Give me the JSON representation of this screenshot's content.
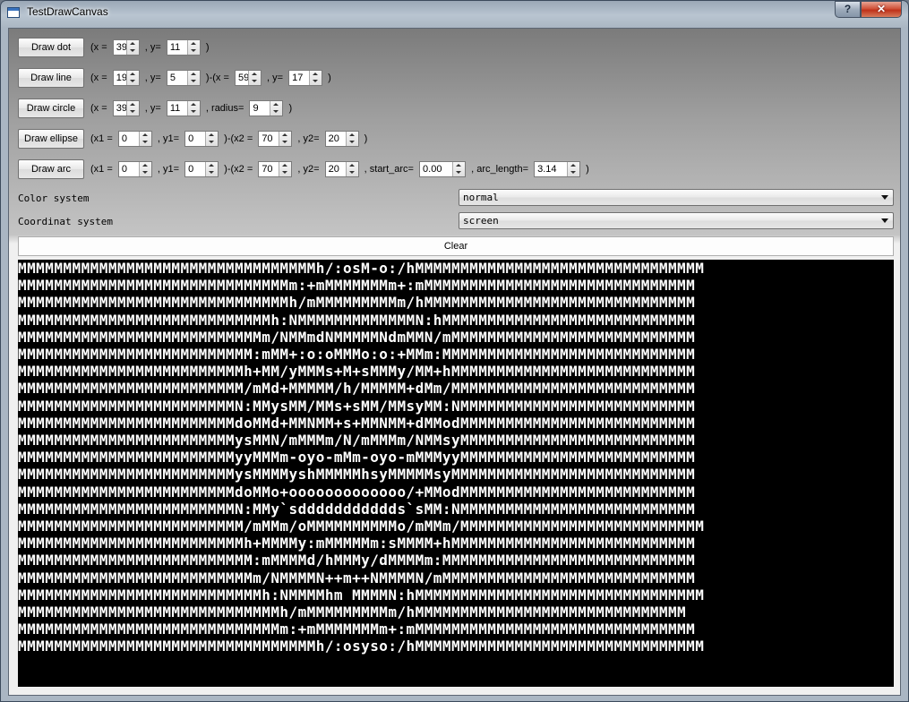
{
  "window": {
    "title": "TestDrawCanvas",
    "help_label": "?",
    "close_label": "✕",
    "app_icon": "window-app-icon"
  },
  "rows": [
    {
      "button": "Draw dot",
      "parts": [
        {
          "t": "lbl",
          "v": "(x = "
        },
        {
          "t": "spin",
          "v": "39",
          "w": 30
        },
        {
          "t": "lbl",
          "v": " , y= "
        },
        {
          "t": "spin",
          "v": "11",
          "w": 38
        },
        {
          "t": "lbl",
          "v": " )"
        }
      ]
    },
    {
      "button": "Draw line",
      "parts": [
        {
          "t": "lbl",
          "v": "(x = "
        },
        {
          "t": "spin",
          "v": "19",
          "w": 30
        },
        {
          "t": "lbl",
          "v": " , y= "
        },
        {
          "t": "spin",
          "v": "5",
          "w": 38
        },
        {
          "t": "lbl",
          "v": " )-(x = "
        },
        {
          "t": "spin",
          "v": "59",
          "w": 30
        },
        {
          "t": "lbl",
          "v": " , y= "
        },
        {
          "t": "spin",
          "v": "17",
          "w": 38
        },
        {
          "t": "lbl",
          "v": " )"
        }
      ]
    },
    {
      "button": "Draw circle",
      "parts": [
        {
          "t": "lbl",
          "v": "(x = "
        },
        {
          "t": "spin",
          "v": "39",
          "w": 30
        },
        {
          "t": "lbl",
          "v": " , y= "
        },
        {
          "t": "spin",
          "v": "11",
          "w": 38
        },
        {
          "t": "lbl",
          "v": " , radius= "
        },
        {
          "t": "spin",
          "v": "9",
          "w": 38
        },
        {
          "t": "lbl",
          "v": " )"
        }
      ]
    },
    {
      "button": "Draw ellipse",
      "parts": [
        {
          "t": "lbl",
          "v": "(x1 = "
        },
        {
          "t": "spin",
          "v": "0",
          "w": 38
        },
        {
          "t": "lbl",
          "v": " , y1= "
        },
        {
          "t": "spin",
          "v": "0",
          "w": 38
        },
        {
          "t": "lbl",
          "v": " )-(x2 = "
        },
        {
          "t": "spin",
          "v": "70",
          "w": 38
        },
        {
          "t": "lbl",
          "v": " , y2= "
        },
        {
          "t": "spin",
          "v": "20",
          "w": 38
        },
        {
          "t": "lbl",
          "v": " )"
        }
      ]
    },
    {
      "button": "Draw arc",
      "parts": [
        {
          "t": "lbl",
          "v": "(x1 = "
        },
        {
          "t": "spin",
          "v": "0",
          "w": 38
        },
        {
          "t": "lbl",
          "v": " , y1= "
        },
        {
          "t": "spin",
          "v": "0",
          "w": 38
        },
        {
          "t": "lbl",
          "v": " )-(x2 = "
        },
        {
          "t": "spin",
          "v": "70",
          "w": 38
        },
        {
          "t": "lbl",
          "v": " , y2= "
        },
        {
          "t": "spin",
          "v": "20",
          "w": 38
        },
        {
          "t": "lbl",
          "v": " , start_arc= "
        },
        {
          "t": "spin",
          "v": "0.00",
          "w": 52
        },
        {
          "t": "lbl",
          "v": " , arc_length= "
        },
        {
          "t": "spin",
          "v": "3.14",
          "w": 52
        },
        {
          "t": "lbl",
          "v": " )"
        }
      ]
    }
  ],
  "color_system": {
    "label": "Color system",
    "value": "normal"
  },
  "coord_system": {
    "label": "Coordinat system",
    "value": "screen"
  },
  "clear_label": "Clear",
  "canvas_lines": [
    "MMMMMMMMMMMMMMMMMMMMMMMMMMMMMMMMMh/:osM-o:/hMMMMMMMMMMMMMMMMMMMMMMMMMMMMMMMM",
    "MMMMMMMMMMMMMMMMMMMMMMMMMMMMMMm:+mMMMMMMMm+:mMMMMMMMMMMMMMMMMMMMMMMMMMMMMMM",
    "MMMMMMMMMMMMMMMMMMMMMMMMMMMMMMh/mMMMMMMMMMm/hMMMMMMMMMMMMMMMMMMMMMMMMMMMMMM",
    "MMMMMMMMMMMMMMMMMMMMMMMMMMMMh:NMMMMMMMMMMMMMN:hMMMMMMMMMMMMMMMMMMMMMMMMMMMM",
    "MMMMMMMMMMMMMMMMMMMMMMMMMMMm/NMMmdNMMMMMNdmMMN/mMMMMMMMMMMMMMMMMMMMMMMMMMMM",
    "MMMMMMMMMMMMMMMMMMMMMMMMMM:mMM+:o:oMMMo:o:+MMm:MMMMMMMMMMMMMMMMMMMMMMMMMMMM",
    "MMMMMMMMMMMMMMMMMMMMMMMMMh+MM/yMMMs+M+sMMMy/MM+hMMMMMMMMMMMMMMMMMMMMMMMMMMM",
    "MMMMMMMMMMMMMMMMMMMMMMMMM/mMd+MMMMM/h/MMMMM+dMm/MMMMMMMMMMMMMMMMMMMMMMMMMMM",
    "MMMMMMMMMMMMMMMMMMMMMMMMN:MMysMM/MMs+sMM/MMsyMM:NMMMMMMMMMMMMMMMMMMMMMMMMMM",
    "MMMMMMMMMMMMMMMMMMMMMMMMdoMMd+MMNMM+s+MMNMM+dMModMMMMMMMMMMMMMMMMMMMMMMMMMM",
    "MMMMMMMMMMMMMMMMMMMMMMMMysMMN/mMMMm/N/mMMMm/NMMsyMMMMMMMMMMMMMMMMMMMMMMMMMM",
    "MMMMMMMMMMMMMMMMMMMMMMMMyyMMMm-oyo-mMm-oyo-mMMMyyMMMMMMMMMMMMMMMMMMMMMMMMMM",
    "MMMMMMMMMMMMMMMMMMMMMMMMysMMMMyshMMMMMhsyMMMMMsyMMMMMMMMMMMMMMMMMMMMMMMMMMM",
    "MMMMMMMMMMMMMMMMMMMMMMMMdoMMo+ooooooooooooo/+MModMMMMMMMMMMMMMMMMMMMMMMMMMM",
    "MMMMMMMMMMMMMMMMMMMMMMMMN:MMy`sddddddddddds`sMM:NMMMMMMMMMMMMMMMMMMMMMMMMMM",
    "MMMMMMMMMMMMMMMMMMMMMMMMM/mMMm/oMMMMMMMMMMo/mMMm/MMMMMMMMMMMMMMMMMMMMMMMMMMM",
    "MMMMMMMMMMMMMMMMMMMMMMMMMh+MMMMy:mMMMMMm:sMMMM+hMMMMMMMMMMMMMMMMMMMMMMMMMMM",
    "MMMMMMMMMMMMMMMMMMMMMMMMMM:mMMMMd/hMMMy/dMMMMm:MMMMMMMMMMMMMMMMMMMMMMMMMMMM",
    "MMMMMMMMMMMMMMMMMMMMMMMMMMm/NMMMMN++m++NMMMMN/mMMMMMMMMMMMMMMMMMMMMMMMMMMMM",
    "MMMMMMMMMMMMMMMMMMMMMMMMMMMh:NMMMMhm MMMMN:hMMMMMMMMMMMMMMMMMMMMMMMMMMMMMMMM",
    "MMMMMMMMMMMMMMMMMMMMMMMMMMMMMh/mMMMMMMMMMm/hMMMMMMMMMMMMMMMMMMMMMMMMMMMMMM",
    "MMMMMMMMMMMMMMMMMMMMMMMMMMMMMm:+mMMMMMMMm+:mMMMMMMMMMMMMMMMMMMMMMMMMMMMMMMM",
    "MMMMMMMMMMMMMMMMMMMMMMMMMMMMMMMMMh/:osyso:/hMMMMMMMMMMMMMMMMMMMMMMMMMMMMMMMM"
  ]
}
